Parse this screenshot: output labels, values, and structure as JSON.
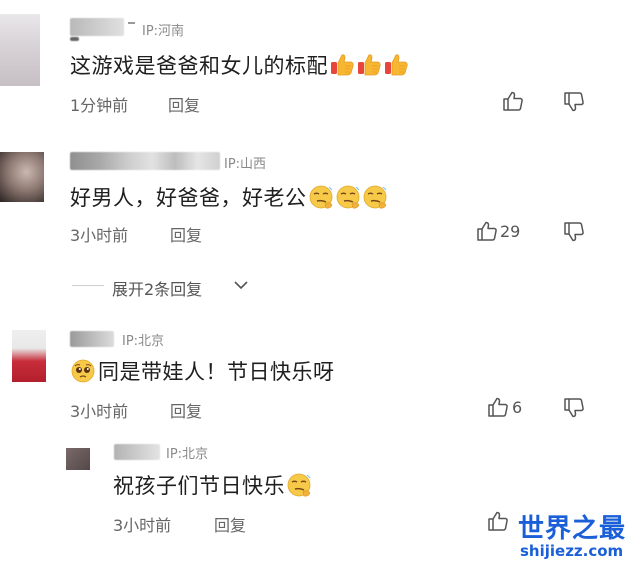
{
  "comments": [
    {
      "ip": "IP:河南",
      "text": "这游戏是爸爸和女儿的标配",
      "emoji": [
        "thumbs-up-emoji",
        "thumbs-up-emoji",
        "thumbs-up-emoji"
      ],
      "time": "1分钟前",
      "reply_label": "回复",
      "likes": ""
    },
    {
      "ip": "IP:山西",
      "text": "好男人，好爸爸，好老公",
      "emoji": [
        "smirk-emoji",
        "smirk-emoji",
        "smirk-emoji"
      ],
      "time": "3小时前",
      "reply_label": "回复",
      "likes": "29",
      "expand_label": "展开2条回复"
    },
    {
      "ip": "IP:北京",
      "text": "同是带娃人！节日快乐呀",
      "emoji": [
        "pleading-face-emoji"
      ],
      "time": "3小时前",
      "reply_label": "回复",
      "likes": "6"
    },
    {
      "ip": "IP:北京",
      "text": "祝孩子们节日快乐",
      "emoji": [
        "smirk-emoji"
      ],
      "time": "3小时前",
      "reply_label": "回复",
      "likes": ""
    }
  ],
  "watermark": {
    "title": "世界之最",
    "url": "shijiezz.com"
  },
  "colors": {
    "watermark": "#1a5fd8",
    "meta_text": "#666666",
    "ip_text": "#8a8a8a"
  }
}
